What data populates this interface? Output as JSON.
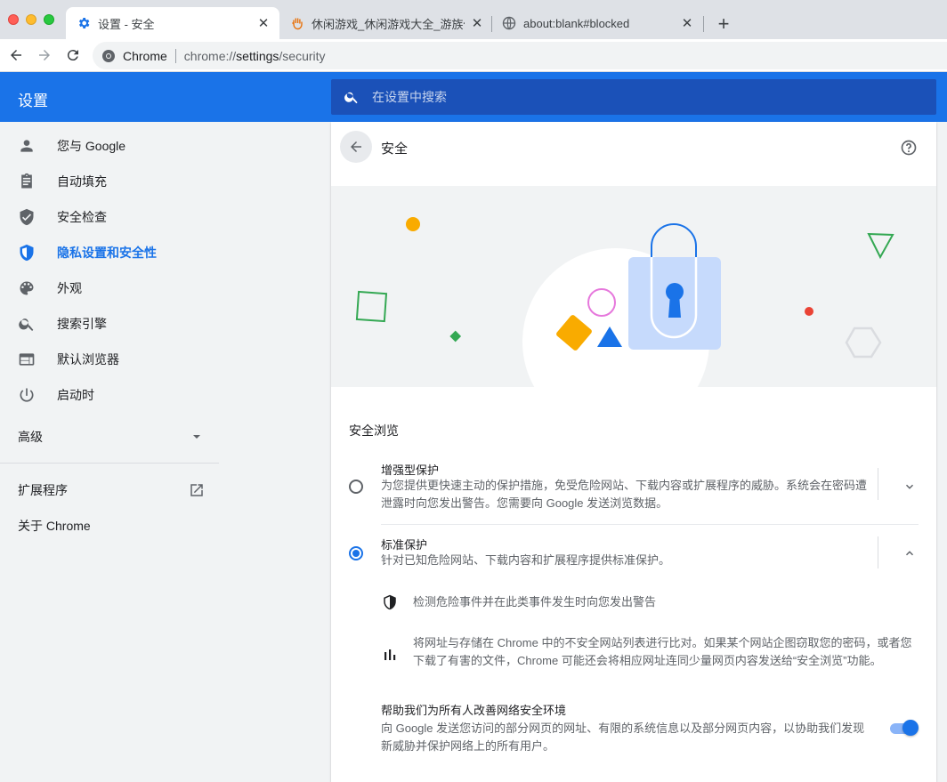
{
  "browser": {
    "tabs": [
      {
        "title": "设置 - 安全",
        "icon": "gear-icon",
        "active": true
      },
      {
        "title": "休闲游戏_休闲游戏大全_游族休闲",
        "icon": "hand-icon",
        "active": false
      },
      {
        "title": "about:blank#blocked",
        "icon": "globe-icon",
        "active": false
      }
    ],
    "new_tab": "+",
    "close_glyph": "✕",
    "omnibox": {
      "site_label": "Chrome",
      "url_prefix": "chrome://",
      "url_host": "settings",
      "url_path": "/security"
    }
  },
  "settings": {
    "header_title": "设置",
    "search_placeholder": "在设置中搜索"
  },
  "sidebar": {
    "items": [
      {
        "label": "您与 Google",
        "icon": "person-icon"
      },
      {
        "label": "自动填充",
        "icon": "clipboard-icon"
      },
      {
        "label": "安全检查",
        "icon": "shield-check-icon"
      },
      {
        "label": "隐私设置和安全性",
        "icon": "shield-icon",
        "selected": true
      },
      {
        "label": "外观",
        "icon": "palette-icon"
      },
      {
        "label": "搜索引擎",
        "icon": "search-icon"
      },
      {
        "label": "默认浏览器",
        "icon": "browser-icon"
      },
      {
        "label": "启动时",
        "icon": "power-icon"
      }
    ],
    "advanced": "高级",
    "extensions": "扩展程序",
    "about": "关于 Chrome"
  },
  "page": {
    "title": "安全",
    "section_title": "安全浏览",
    "options": [
      {
        "title": "增强型保护",
        "desc": "为您提供更快速主动的保护措施，免受危险网站、下载内容或扩展程序的威胁。系统会在密码遭泄露时向您发出警告。您需要向 Google 发送浏览数据。",
        "selected": false,
        "expanded": false
      },
      {
        "title": "标准保护",
        "desc": "针对已知危险网站、下载内容和扩展程序提供标准保护。",
        "selected": true,
        "expanded": true
      }
    ],
    "details": [
      {
        "icon": "shield-half-icon",
        "text": "检测危险事件并在此类事件发生时向您发出警告"
      },
      {
        "icon": "bar-chart-icon",
        "text": "将网址与存储在 Chrome 中的不安全网站列表进行比对。如果某个网站企图窃取您的密码，或者您下载了有害的文件，Chrome 可能还会将相应网址连同少量网页内容发送给“安全浏览”功能。"
      }
    ],
    "improve": {
      "title": "帮助我们为所有人改善网络安全环境",
      "desc": "向 Google 发送您访问的部分网页的网址、有限的系统信息以及部分网页内容，以协助我们发现新威胁并保护网络上的所有用户。",
      "enabled": true
    }
  },
  "colors": {
    "accent": "#1a73e8",
    "header": "#1a73e8",
    "search_bg": "#1b51b8"
  }
}
